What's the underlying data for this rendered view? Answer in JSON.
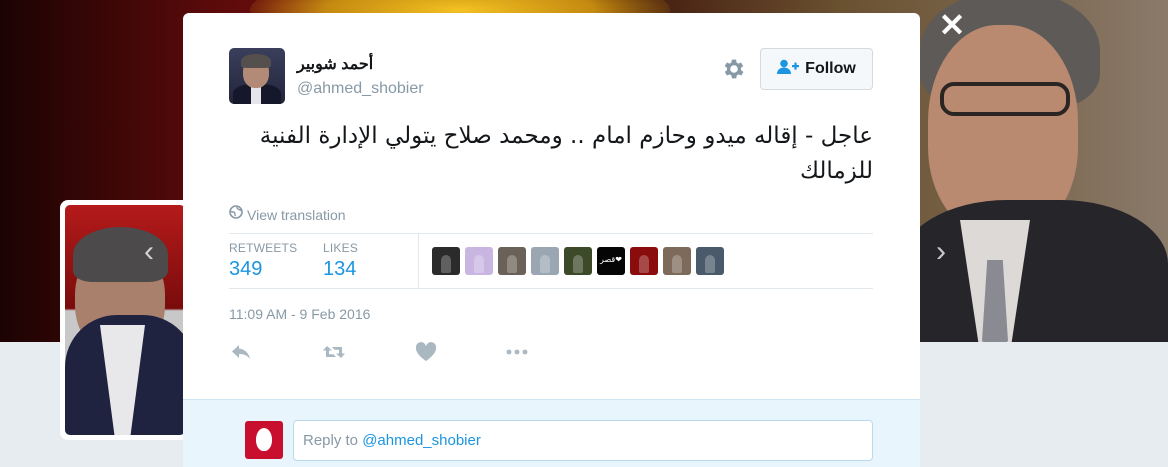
{
  "tweet": {
    "author": {
      "name": "أحمد شوبير",
      "handle": "@ahmed_shobier"
    },
    "follow_label": "Follow",
    "text": "عاجل - إقاله ميدو وحازم امام .. ومحمد صلاح يتولي الإدارة الفنية للزمالك",
    "translate_label": "View translation",
    "stats": {
      "retweets_label": "RETWEETS",
      "retweets_value": "349",
      "likes_label": "LIKES",
      "likes_value": "134"
    },
    "likers": [
      {
        "icon": "liker-avatar",
        "color": "#2b2b2b"
      },
      {
        "icon": "liker-avatar",
        "color": "#c9b6e0"
      },
      {
        "icon": "liker-avatar",
        "color": "#6a6258"
      },
      {
        "icon": "liker-avatar",
        "color": "#9aa7b3"
      },
      {
        "icon": "liker-avatar",
        "color": "#3c4a2a"
      },
      {
        "icon": "liker-avatar",
        "color": "#050505",
        "text": "قصر❤"
      },
      {
        "icon": "liker-avatar",
        "color": "#8a0c0c"
      },
      {
        "icon": "liker-avatar",
        "color": "#7d6a5a"
      },
      {
        "icon": "liker-avatar",
        "color": "#4a5a6a"
      }
    ],
    "timestamp": "11:09 AM - 9 Feb 2016"
  },
  "reply": {
    "prefix": "Reply to ",
    "mention": "@ahmed_shobier"
  },
  "icons": {
    "close": "close-icon",
    "gear": "gear-icon",
    "follow": "add-user-icon",
    "globe": "globe-icon",
    "reply": "reply-icon",
    "retweet": "retweet-icon",
    "like": "heart-icon",
    "more": "more-icon",
    "prev": "chevron-left-icon",
    "next": "chevron-right-icon"
  },
  "colors": {
    "accent": "#1b95e0",
    "muted": "#8899a6",
    "reply_bg": "#e8f5fd",
    "profile_red": "#c8102e"
  }
}
